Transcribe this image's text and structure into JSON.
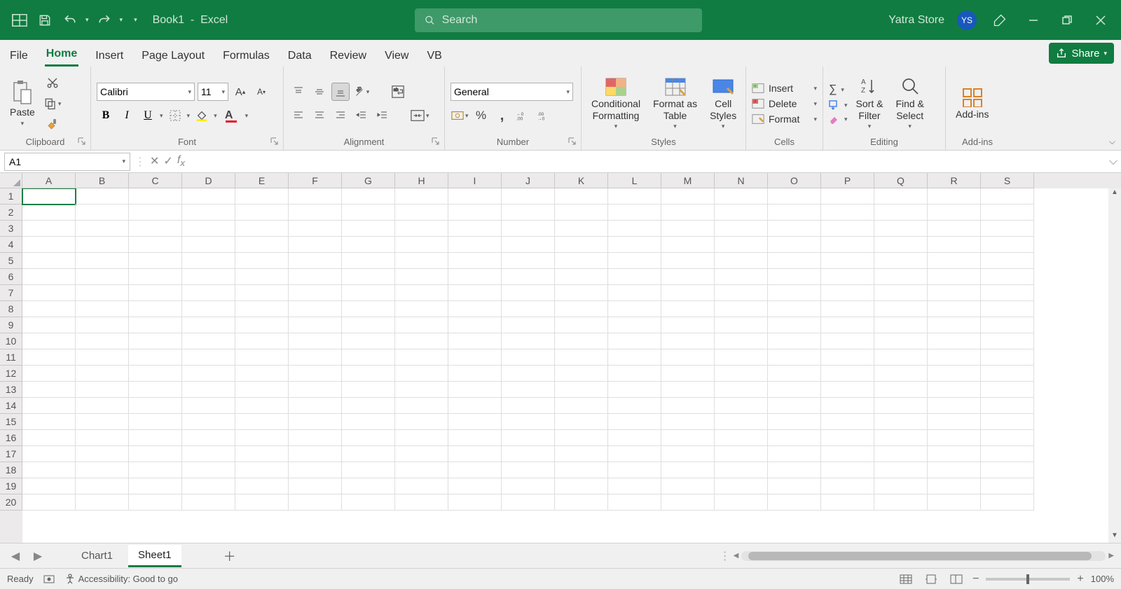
{
  "titlebar": {
    "doc": "Book1",
    "app": "Excel",
    "search_placeholder": "Search",
    "user_name": "Yatra Store",
    "user_initials": "YS"
  },
  "tabs": [
    "File",
    "Home",
    "Insert",
    "Page Layout",
    "Formulas",
    "Data",
    "Review",
    "View",
    "VB"
  ],
  "active_tab": "Home",
  "share_label": "Share",
  "ribbon": {
    "clipboard": {
      "paste": "Paste",
      "label": "Clipboard"
    },
    "font": {
      "name": "Calibri",
      "size": "11",
      "label": "Font"
    },
    "alignment": {
      "label": "Alignment"
    },
    "number": {
      "format": "General",
      "label": "Number"
    },
    "styles": {
      "cond": "Conditional\nFormatting",
      "fmt_table": "Format as\nTable",
      "cell_styles": "Cell\nStyles",
      "label": "Styles"
    },
    "cells": {
      "insert": "Insert",
      "delete": "Delete",
      "format": "Format",
      "label": "Cells"
    },
    "editing": {
      "sort": "Sort &\nFilter",
      "find": "Find &\nSelect",
      "label": "Editing"
    },
    "addins": {
      "btn": "Add-ins",
      "label": "Add-ins"
    }
  },
  "formula_bar": {
    "name_box": "A1",
    "formula": ""
  },
  "columns": [
    "A",
    "B",
    "C",
    "D",
    "E",
    "F",
    "G",
    "H",
    "I",
    "J",
    "K",
    "L",
    "M",
    "N",
    "O",
    "P",
    "Q",
    "R",
    "S"
  ],
  "rows": [
    1,
    2,
    3,
    4,
    5,
    6,
    7,
    8,
    9,
    10,
    11,
    12,
    13,
    14,
    15,
    16,
    17,
    18,
    19,
    20
  ],
  "selected_cell": "A1",
  "sheet_tabs": [
    "Chart1",
    "Sheet1"
  ],
  "active_sheet": "Sheet1",
  "status": {
    "ready": "Ready",
    "accessibility": "Accessibility: Good to go",
    "zoom": "100%"
  }
}
